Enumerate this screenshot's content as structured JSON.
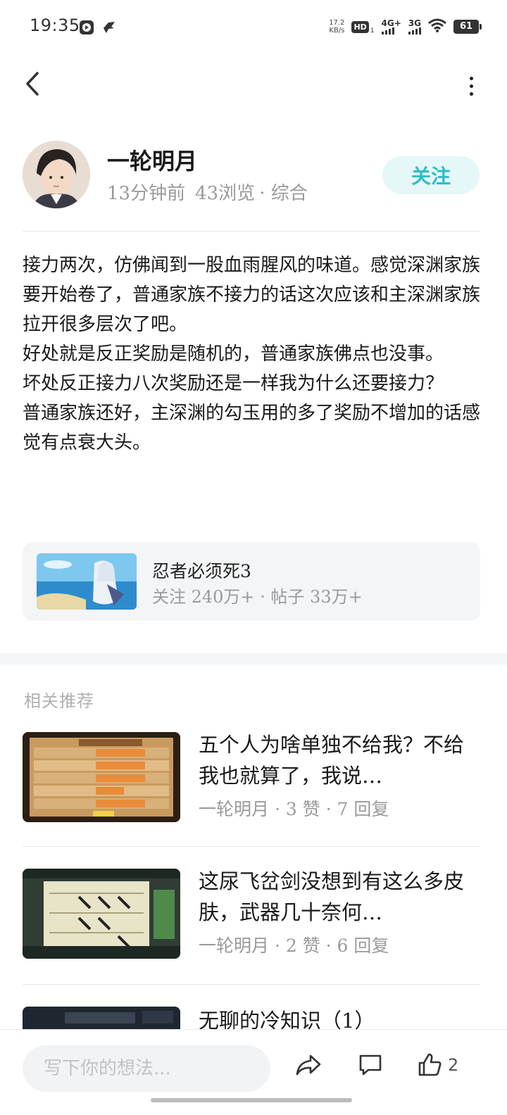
{
  "status_bar": {
    "time": "19:35",
    "net_speed_value": "17.2",
    "net_speed_unit": "KB/s",
    "hd_label": "HD",
    "hd_sub": "1",
    "signal1_label": "4G+",
    "signal2_label": "3G",
    "battery": "61"
  },
  "author": {
    "name": "一轮明月",
    "time_ago": "13分钟前",
    "views": "43浏览",
    "category": "· 综合",
    "follow_label": "关注"
  },
  "post": {
    "paragraphs": [
      "接力两次，仿佛闻到一股血雨腥风的味道。感觉深渊家族要开始卷了，普通家族不接力的话这次应该和主深渊家族拉开很多层次了吧。",
      "好处就是反正奖励是随机的，普通家族佛点也没事。",
      "坏处反正接力八次奖励还是一样我为什么还要接力？",
      "普通家族还好，主深渊的勾玉用的多了奖励不增加的话感觉有点衰大头。"
    ]
  },
  "game_card": {
    "title": "忍者必须死3",
    "meta": "关注 240万+ · 帖子 33万+"
  },
  "recommend": {
    "section_title": "相关推荐",
    "items": [
      {
        "title": "五个人为啥单独不给我？不给我也就算了，我说…",
        "meta": "一轮明月 · 3 赞 · 7 回复"
      },
      {
        "title": "这尿飞岔剑没想到有这么多皮肤，武器几十奈何…",
        "meta": "一轮明月 · 2 赞 · 6 回复"
      },
      {
        "title": "无聊的冷知识（1）",
        "meta": ""
      }
    ]
  },
  "bottom_bar": {
    "input_placeholder": "写下你的想法...",
    "like_count": "2"
  },
  "colors": {
    "accent": "#2bbfc6",
    "follow_bg": "#e6f7f8",
    "muted_text": "#9a9a9a"
  },
  "icons": {
    "back": "chevron-left-icon",
    "more": "more-vertical-icon",
    "share": "share-icon",
    "comment": "comment-icon",
    "like": "thumbs-up-icon"
  }
}
